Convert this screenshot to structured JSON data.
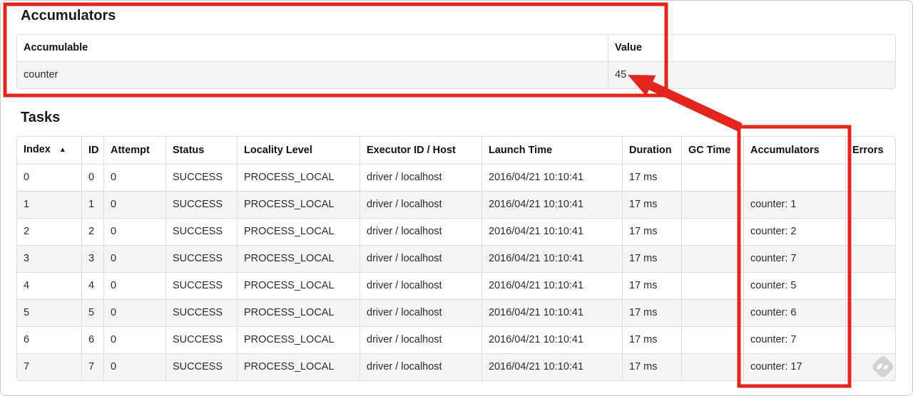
{
  "annotations": {
    "highlight_color": "#e2261d"
  },
  "accumulators_section": {
    "title": "Accumulators",
    "table": {
      "headers": {
        "accumulable": "Accumulable",
        "value": "Value"
      },
      "rows": [
        {
          "accumulable": "counter",
          "value": "45"
        }
      ]
    }
  },
  "tasks_section": {
    "title": "Tasks",
    "table": {
      "sort_indicator": "▲",
      "headers": {
        "index": "Index",
        "id": "ID",
        "attempt": "Attempt",
        "status": "Status",
        "locality": "Locality Level",
        "executor": "Executor ID / Host",
        "launch": "Launch Time",
        "duration": "Duration",
        "gc": "GC Time",
        "accumulators": "Accumulators",
        "errors": "Errors"
      },
      "rows": [
        {
          "index": "0",
          "id": "0",
          "attempt": "0",
          "status": "SUCCESS",
          "locality": "PROCESS_LOCAL",
          "executor": "driver / localhost",
          "launch": "2016/04/21 10:10:41",
          "duration": "17 ms",
          "gc": "",
          "accumulators": "",
          "errors": ""
        },
        {
          "index": "1",
          "id": "1",
          "attempt": "0",
          "status": "SUCCESS",
          "locality": "PROCESS_LOCAL",
          "executor": "driver / localhost",
          "launch": "2016/04/21 10:10:41",
          "duration": "17 ms",
          "gc": "",
          "accumulators": "counter: 1",
          "errors": ""
        },
        {
          "index": "2",
          "id": "2",
          "attempt": "0",
          "status": "SUCCESS",
          "locality": "PROCESS_LOCAL",
          "executor": "driver / localhost",
          "launch": "2016/04/21 10:10:41",
          "duration": "17 ms",
          "gc": "",
          "accumulators": "counter: 2",
          "errors": ""
        },
        {
          "index": "3",
          "id": "3",
          "attempt": "0",
          "status": "SUCCESS",
          "locality": "PROCESS_LOCAL",
          "executor": "driver / localhost",
          "launch": "2016/04/21 10:10:41",
          "duration": "17 ms",
          "gc": "",
          "accumulators": "counter: 7",
          "errors": ""
        },
        {
          "index": "4",
          "id": "4",
          "attempt": "0",
          "status": "SUCCESS",
          "locality": "PROCESS_LOCAL",
          "executor": "driver / localhost",
          "launch": "2016/04/21 10:10:41",
          "duration": "17 ms",
          "gc": "",
          "accumulators": "counter: 5",
          "errors": ""
        },
        {
          "index": "5",
          "id": "5",
          "attempt": "0",
          "status": "SUCCESS",
          "locality": "PROCESS_LOCAL",
          "executor": "driver / localhost",
          "launch": "2016/04/21 10:10:41",
          "duration": "17 ms",
          "gc": "",
          "accumulators": "counter: 6",
          "errors": ""
        },
        {
          "index": "6",
          "id": "6",
          "attempt": "0",
          "status": "SUCCESS",
          "locality": "PROCESS_LOCAL",
          "executor": "driver / localhost",
          "launch": "2016/04/21 10:10:41",
          "duration": "17 ms",
          "gc": "",
          "accumulators": "counter: 7",
          "errors": ""
        },
        {
          "index": "7",
          "id": "7",
          "attempt": "0",
          "status": "SUCCESS",
          "locality": "PROCESS_LOCAL",
          "executor": "driver / localhost",
          "launch": "2016/04/21 10:10:41",
          "duration": "17 ms",
          "gc": "",
          "accumulators": "counter: 17",
          "errors": ""
        }
      ]
    }
  },
  "watermark": {
    "name": "feedly-logo"
  }
}
